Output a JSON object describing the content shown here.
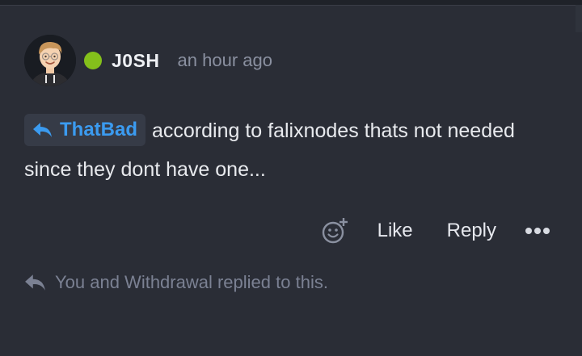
{
  "post": {
    "author": {
      "name": "J0SH",
      "status_color": "#84c01b",
      "avatar_icon": "cartoon-avatar-icon"
    },
    "timestamp": "an hour ago",
    "reply_to": {
      "icon": "reply-arrow-icon",
      "name": "ThatBad"
    },
    "message": "according to falixnodes thats not needed since they dont have one...",
    "actions": {
      "react_icon": "add-reaction-icon",
      "like_label": "Like",
      "reply_label": "Reply",
      "more_icon": "more-options-icon"
    },
    "replies_summary": {
      "icon": "reply-arrow-icon",
      "text": "You and Withdrawal replied to this."
    }
  },
  "colors": {
    "background": "#2a2d36",
    "mention": "#3b9bf0",
    "online": "#84c01b",
    "muted": "#7b8193"
  }
}
